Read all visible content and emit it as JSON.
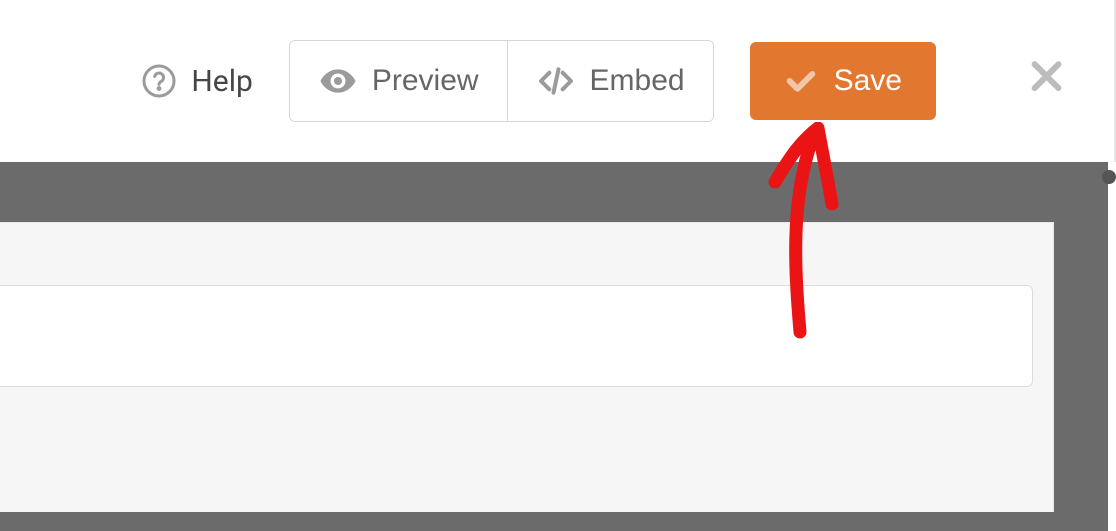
{
  "toolbar": {
    "help_label": "Help",
    "preview_label": "Preview",
    "embed_label": "Embed",
    "save_label": "Save"
  },
  "colors": {
    "accent": "#e27730",
    "annotation": "#eb1414"
  }
}
